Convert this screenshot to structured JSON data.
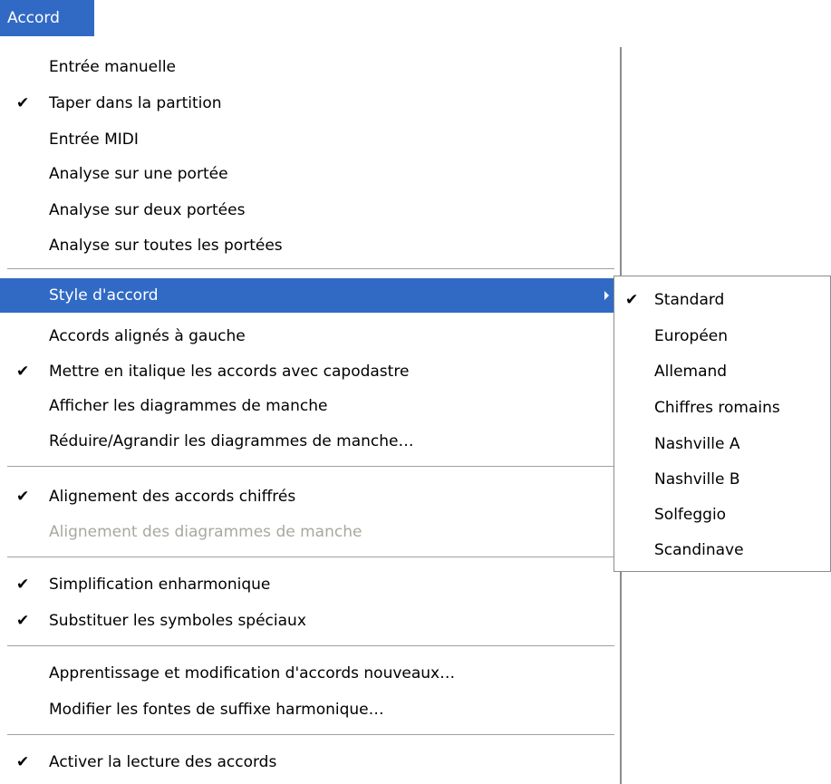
{
  "menubar": {
    "title": "Accord"
  },
  "menu": {
    "items": [
      {
        "label": "Entrée manuelle",
        "checked": false
      },
      {
        "label": "Taper dans la partition",
        "checked": true
      },
      {
        "label": "Entrée MIDI",
        "checked": false
      },
      {
        "label": "Analyse sur une portée",
        "checked": false
      },
      {
        "label": "Analyse sur deux portées",
        "checked": false
      },
      {
        "label": "Analyse sur toutes les portées",
        "checked": false
      },
      {
        "label": "Style d'accord",
        "checked": false,
        "highlighted": true,
        "has_submenu": true
      },
      {
        "label": "Accords alignés à gauche",
        "checked": false
      },
      {
        "label": "Mettre en italique les accords avec capodastre",
        "checked": true
      },
      {
        "label": "Afficher les diagrammes de manche",
        "checked": false
      },
      {
        "label": "Réduire/Agrandir les diagrammes de manche…",
        "checked": false
      },
      {
        "label": "Alignement des accords chiffrés",
        "checked": true
      },
      {
        "label": "Alignement des diagrammes de manche",
        "checked": false,
        "disabled": true
      },
      {
        "label": "Simplification enharmonique",
        "checked": true
      },
      {
        "label": "Substituer les symboles spéciaux",
        "checked": true
      },
      {
        "label": "Apprentissage et modification d'accords nouveaux…",
        "checked": false
      },
      {
        "label": "Modifier les fontes de suffixe harmonique…",
        "checked": false
      },
      {
        "label": "Activer la lecture des accords",
        "checked": true
      }
    ]
  },
  "submenu": {
    "items": [
      {
        "label": "Standard",
        "checked": true
      },
      {
        "label": "Européen",
        "checked": false
      },
      {
        "label": "Allemand",
        "checked": false
      },
      {
        "label": "Chiffres romains",
        "checked": false
      },
      {
        "label": "Nashville A",
        "checked": false
      },
      {
        "label": "Nashville B",
        "checked": false
      },
      {
        "label": "Solfeggio",
        "checked": false
      },
      {
        "label": "Scandinave",
        "checked": false
      }
    ]
  },
  "glyphs": {
    "check": "✔"
  },
  "colors": {
    "highlight": "#316ac5",
    "disabled_text": "#a8a8a0"
  }
}
